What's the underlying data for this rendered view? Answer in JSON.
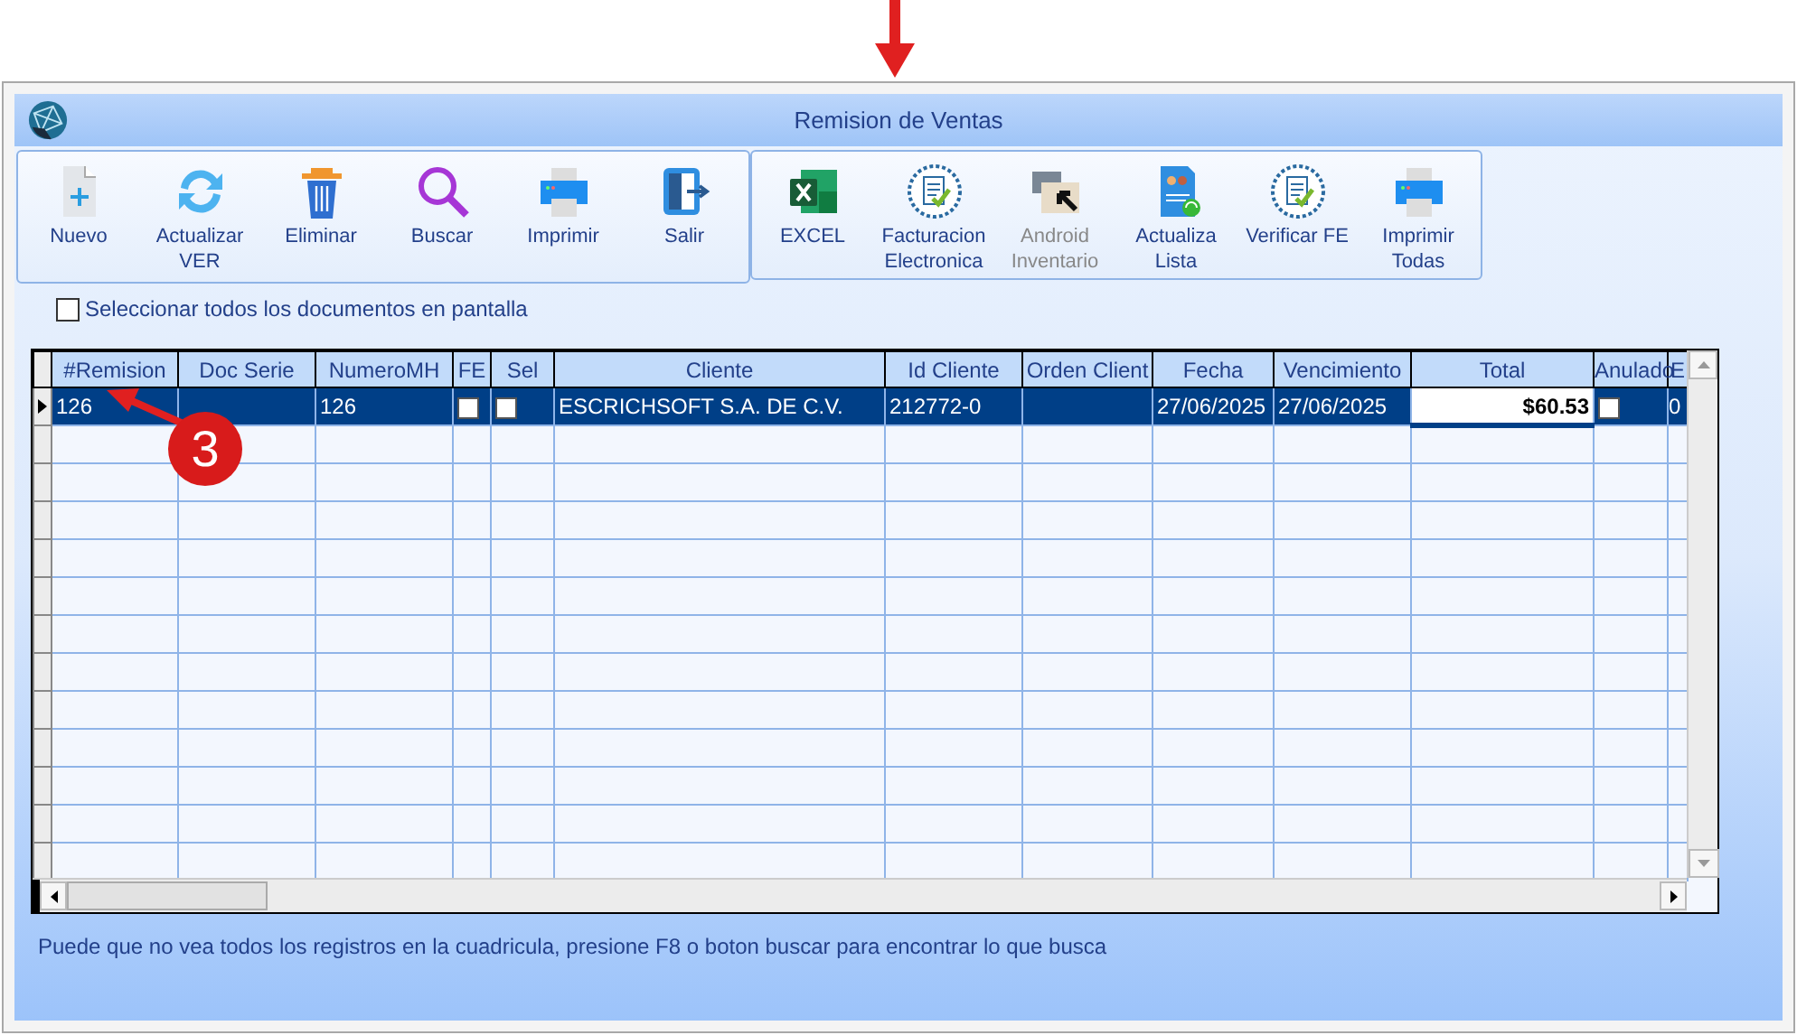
{
  "window": {
    "title": "Remision de Ventas"
  },
  "toolbar_groups": [
    {
      "buttons": [
        {
          "label": "Nuevo",
          "disabled": false
        },
        {
          "label": "Actualizar\nVER",
          "disabled": false
        },
        {
          "label": "Eliminar",
          "disabled": false
        },
        {
          "label": "Buscar",
          "disabled": false
        },
        {
          "label": "Imprimir",
          "disabled": false
        },
        {
          "label": "Salir",
          "disabled": false
        }
      ]
    },
    {
      "buttons": [
        {
          "label": "EXCEL",
          "disabled": false
        },
        {
          "label": "Facturacion\nElectronica",
          "disabled": false
        },
        {
          "label": "Android\nInventario",
          "disabled": true
        },
        {
          "label": "Actualiza\nLista",
          "disabled": false
        },
        {
          "label": "Verificar FE",
          "disabled": false
        },
        {
          "label": "Imprimir\nTodas",
          "disabled": false
        }
      ]
    }
  ],
  "select_all": {
    "label": "Seleccionar todos los documentos en pantalla",
    "checked": false
  },
  "table": {
    "columns": [
      "#Remision",
      "Doc Serie",
      "NumeroMH",
      "FE",
      "Sel",
      "Cliente",
      "Id Cliente",
      "Orden Client",
      "Fecha",
      "Vencimiento",
      "Total",
      "Anulado",
      "E"
    ],
    "rows": [
      {
        "selected": true,
        "cells": [
          {
            "kind": "text",
            "text": "126",
            "focused": false
          },
          {
            "kind": "blank",
            "focused": false
          },
          {
            "kind": "text",
            "text": "126",
            "focused": false
          },
          {
            "kind": "checkbox",
            "checked": false,
            "focused": false
          },
          {
            "kind": "checkbox",
            "checked": false,
            "focused": false
          },
          {
            "kind": "text",
            "text": "ESCRICHSOFT S.A. DE C.V.",
            "focused": false
          },
          {
            "kind": "text",
            "text": "212772-0",
            "focused": false
          },
          {
            "kind": "blank",
            "focused": false
          },
          {
            "kind": "text",
            "text": "27/06/2025",
            "focused": false
          },
          {
            "kind": "text",
            "text": "27/06/2025",
            "focused": false
          },
          {
            "kind": "number",
            "text": "$60.53",
            "focused": true
          },
          {
            "kind": "checkbox",
            "checked": false,
            "focused": false
          },
          {
            "kind": "text",
            "text": "0",
            "focused": false
          }
        ]
      }
    ]
  },
  "hint": "Puede que no vea todos los registros en la cuadricula, presione F8 o boton buscar para encontrar lo que busca",
  "annotation": {
    "badge": "3"
  }
}
